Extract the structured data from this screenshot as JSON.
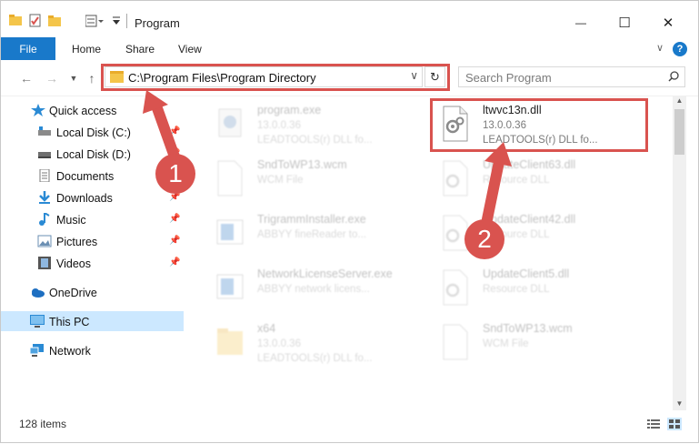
{
  "window": {
    "title": "Program",
    "controls": {
      "minimize": "—",
      "maximize": "☐",
      "close": "✕"
    }
  },
  "ribbon": {
    "file_tab": "File",
    "tabs": [
      "Home",
      "Share",
      "View"
    ]
  },
  "address_bar": {
    "path": "C:\\Program Files\\Program Directory",
    "search_placeholder": "Search Program"
  },
  "sidebar": {
    "quick_access": "Quick access",
    "items": [
      {
        "label": "Local Disk (C:)",
        "icon": "drive-icon",
        "pinned": true
      },
      {
        "label": "Local Disk (D:)",
        "icon": "drive-icon",
        "pinned": true
      },
      {
        "label": "Documents",
        "icon": "documents-icon",
        "pinned": true
      },
      {
        "label": "Downloads",
        "icon": "downloads-icon",
        "pinned": true
      },
      {
        "label": "Music",
        "icon": "music-icon",
        "pinned": true
      },
      {
        "label": "Pictures",
        "icon": "pictures-icon",
        "pinned": true
      },
      {
        "label": "Videos",
        "icon": "videos-icon",
        "pinned": true
      }
    ],
    "onedrive": "OneDrive",
    "this_pc": "This PC",
    "network": "Network"
  },
  "files": [
    {
      "name": "program.exe",
      "sub1": "13.0.0.36",
      "sub2": "LEADTOOLS(r) DLL fo...",
      "kind": "exe"
    },
    {
      "name": "ltwvc13n.dll",
      "sub1": "13.0.0.36",
      "sub2": "LEADTOOLS(r) DLL fo...",
      "kind": "dll",
      "highlighted": true
    },
    {
      "name": "SndToWP13.wcm",
      "sub1": "WCM File",
      "sub2": "",
      "kind": "blank"
    },
    {
      "name": "UpdateClient63.dll",
      "sub1": "Resource DLL",
      "sub2": "",
      "kind": "dll"
    },
    {
      "name": "TrigrammInstaller.exe",
      "sub1": "ABBYY fineReader to...",
      "sub2": "",
      "kind": "app"
    },
    {
      "name": "UpdateClient42.dll",
      "sub1": "Resource DLL",
      "sub2": "",
      "kind": "dll"
    },
    {
      "name": "NetworkLicenseServer.exe",
      "sub1": "ABBYY network licens...",
      "sub2": "",
      "kind": "app"
    },
    {
      "name": "UpdateClient5.dll",
      "sub1": "Resource DLL",
      "sub2": "",
      "kind": "dll"
    },
    {
      "name": "x64",
      "sub1": "13.0.0.36",
      "sub2": "LEADTOOLS(r) DLL fo...",
      "kind": "folder"
    },
    {
      "name": "SndToWP13.wcm",
      "sub1": "WCM File",
      "sub2": "",
      "kind": "blank"
    }
  ],
  "status": {
    "item_count": "128 items"
  },
  "callouts": [
    "1",
    "2"
  ],
  "colors": {
    "accent": "#1979ca",
    "highlight": "#d9534f",
    "selected": "#cce8ff"
  }
}
